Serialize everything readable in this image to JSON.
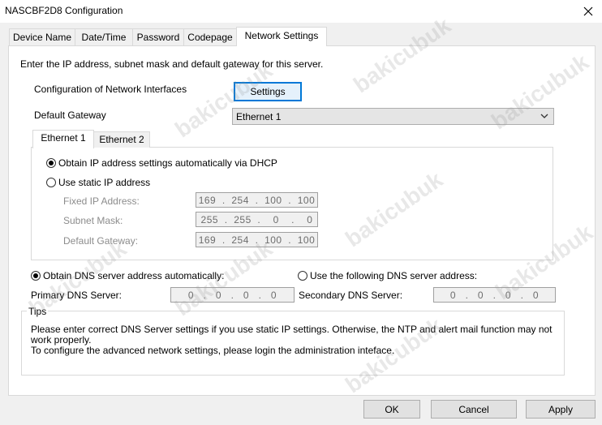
{
  "window": {
    "title": "NASCBF2D8 Configuration"
  },
  "tabs": [
    {
      "label": "Device Name"
    },
    {
      "label": "Date/Time"
    },
    {
      "label": "Password"
    },
    {
      "label": "Codepage"
    },
    {
      "label": "Network Settings",
      "active": true
    }
  ],
  "network": {
    "intro": "Enter the IP address, subnet mask and default gateway for this server.",
    "interfaces_label": "Configuration of Network Interfaces",
    "settings_button": "Settings",
    "default_gateway_label": "Default Gateway",
    "default_gateway_value": "Ethernet 1",
    "subtabs": [
      {
        "label": "Ethernet 1",
        "active": true
      },
      {
        "label": "Ethernet 2"
      }
    ],
    "dhcp_label": "Obtain IP address settings automatically via DHCP",
    "dhcp_selected": true,
    "static_label": "Use static IP address",
    "fixed_ip_label": "Fixed IP Address:",
    "fixed_ip_value": "169  .  254  .  100  .  100",
    "subnet_label": "Subnet Mask:",
    "subnet_value": "255  .  255  .    0    .    0",
    "gateway_label": "Default Gateway:",
    "gateway_value": "169  .  254  .  100  .  100",
    "dns_auto_label": "Obtain DNS server address automatically:",
    "dns_manual_label": "Use the following DNS server address:",
    "primary_dns_label": "Primary DNS Server:",
    "primary_dns_value": "0   .   0   .   0   .   0",
    "secondary_dns_label": "Secondary DNS Server:",
    "secondary_dns_value": "0   .   0   .   0   .   0"
  },
  "tips": {
    "label": "Tips",
    "line1": "Please enter correct DNS Server settings if you use static IP settings.  Otherwise, the NTP and alert mail function may not work properly.",
    "line2": "To configure the advanced network settings, please login the administration inteface."
  },
  "buttons": {
    "ok": "OK",
    "cancel": "Cancel",
    "apply": "Apply"
  },
  "watermark": "bakicubuk",
  "colors": {
    "focus_border": "#0078d7",
    "window_bg": "#f0f0f0",
    "page_bg": "#ffffff"
  }
}
